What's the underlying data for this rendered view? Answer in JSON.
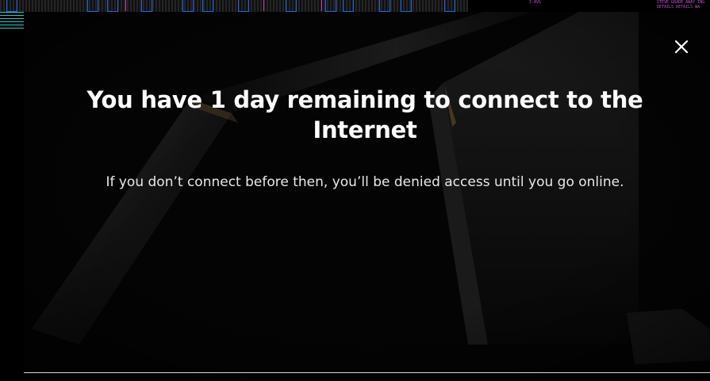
{
  "modal": {
    "title": "You have 1 day remaining to connect to the Internet",
    "message": "If you don’t connect before then, you’ll be denied access until you go online.",
    "close_icon": "close-icon"
  },
  "background": {
    "cad_text_right": "STEVE GRADE AWAY ING\nDETAILS DETAILS WA",
    "cad_text_mid": "I-AVG"
  },
  "colors": {
    "modal_background": "#050505",
    "title_text": "#ffffff",
    "message_text": "#e8e8e8",
    "cad_blue": "#1e73ff",
    "cad_magenta": "#e040d0",
    "cad_cyan": "#2ec8c8"
  }
}
